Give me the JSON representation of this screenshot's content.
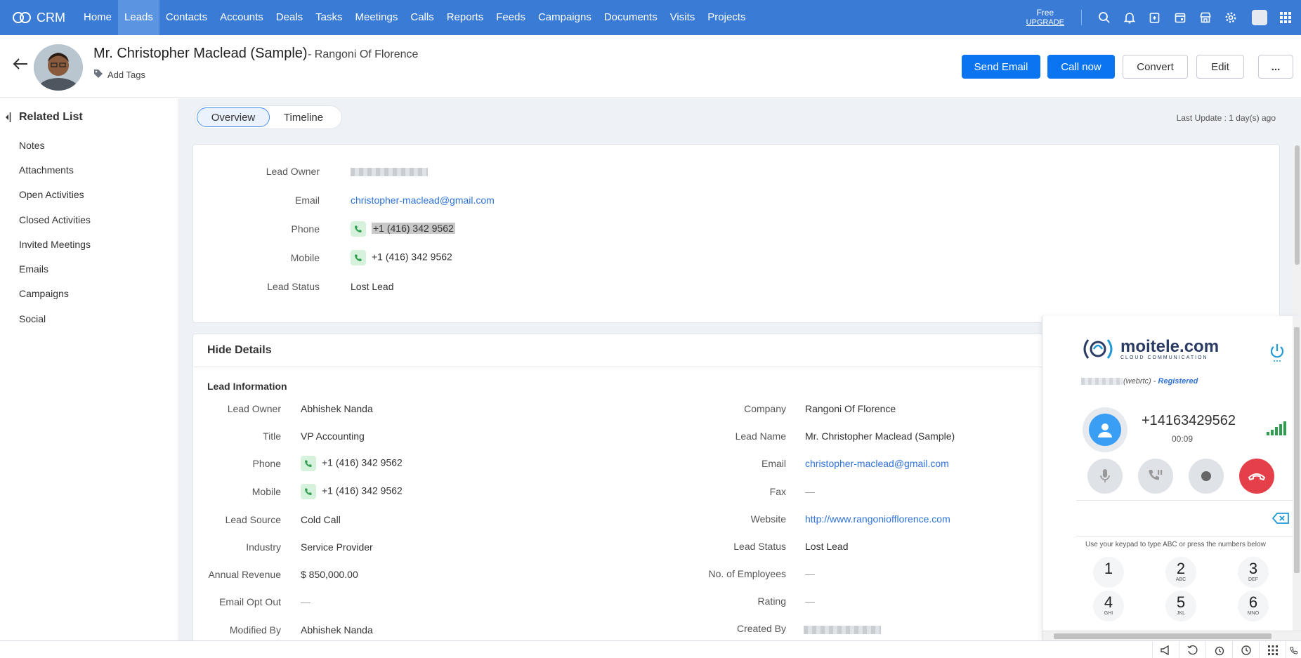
{
  "app": {
    "name": "CRM"
  },
  "nav": {
    "items": [
      "Home",
      "Leads",
      "Contacts",
      "Accounts",
      "Deals",
      "Tasks",
      "Meetings",
      "Calls",
      "Reports",
      "Feeds",
      "Campaigns",
      "Documents",
      "Visits",
      "Projects"
    ],
    "active": "Leads",
    "plan": "Free",
    "upgrade": "UPGRADE",
    "icons": [
      "search-icon",
      "bell-icon",
      "add-note-icon",
      "calendar-icon",
      "marketplace-icon",
      "gear-icon",
      "avatar",
      "apps-grid-icon"
    ]
  },
  "record": {
    "name": "Mr. Christopher Maclead (Sample)",
    "company": "- Rangoni Of Florence",
    "add_tags": "Add Tags",
    "buttons": {
      "send_email": "Send Email",
      "call_now": "Call now",
      "convert": "Convert",
      "edit": "Edit",
      "more": "..."
    }
  },
  "sidebar": {
    "title": "Related List",
    "items": [
      "Notes",
      "Attachments",
      "Open Activities",
      "Closed Activities",
      "Invited Meetings",
      "Emails",
      "Campaigns",
      "Social"
    ]
  },
  "tabs": {
    "overview": "Overview",
    "timeline": "Timeline"
  },
  "last_update": "Last Update : 1 day(s) ago",
  "summary": {
    "labels": {
      "lead_owner": "Lead Owner",
      "email": "Email",
      "phone": "Phone",
      "mobile": "Mobile",
      "lead_status": "Lead Status"
    },
    "email": "christopher-maclead@gmail.com",
    "phone": "+1 (416) 342 9562",
    "mobile": "+1 (416) 342 9562",
    "lead_status": "Lost Lead"
  },
  "details": {
    "title": "Hide Details",
    "section": "Lead Information",
    "left": [
      {
        "label": "Lead Owner",
        "value": "Abhishek Nanda"
      },
      {
        "label": "Title",
        "value": "VP Accounting"
      },
      {
        "label": "Phone",
        "value": "+1 (416) 342 9562"
      },
      {
        "label": "Mobile",
        "value": "+1 (416) 342 9562"
      },
      {
        "label": "Lead Source",
        "value": "Cold Call"
      },
      {
        "label": "Industry",
        "value": "Service Provider"
      },
      {
        "label": "Annual Revenue",
        "value": "$ 850,000.00"
      },
      {
        "label": "Email Opt Out",
        "value": "—"
      },
      {
        "label": "Modified By",
        "value": "Abhishek Nanda"
      }
    ],
    "right": [
      {
        "label": "Company",
        "value": "Rangoni Of Florence"
      },
      {
        "label": "Lead Name",
        "value": "Mr. Christopher Maclead (Sample)"
      },
      {
        "label": "Email",
        "value": "christopher-maclead@gmail.com"
      },
      {
        "label": "Fax",
        "value": "—"
      },
      {
        "label": "Website",
        "value": "http://www.rangoniofflorence.com"
      },
      {
        "label": "Lead Status",
        "value": "Lost Lead"
      },
      {
        "label": "No. of Employees",
        "value": "—"
      },
      {
        "label": "Rating",
        "value": "—"
      },
      {
        "label": "Created By",
        "value": ""
      }
    ]
  },
  "softphone": {
    "brand": "moitele.com",
    "tagline": "CLOUD COMMUNICATION",
    "reg_suffix": "(webrtc) -",
    "reg_status": "Registered",
    "number": "+14163429562",
    "timer": "00:09",
    "hint": "Use your keypad to type ABC or press the numbers below",
    "keys": [
      {
        "d": "1",
        "l": ""
      },
      {
        "d": "2",
        "l": "ABC"
      },
      {
        "d": "3",
        "l": "DEF"
      },
      {
        "d": "4",
        "l": "GHI"
      },
      {
        "d": "5",
        "l": "JKL"
      },
      {
        "d": "6",
        "l": "MNO"
      }
    ]
  },
  "colors": {
    "nav_bg": "#3a7bd5",
    "primary": "#0b74f0",
    "link": "#2d72d9",
    "end_call": "#e5404a"
  }
}
